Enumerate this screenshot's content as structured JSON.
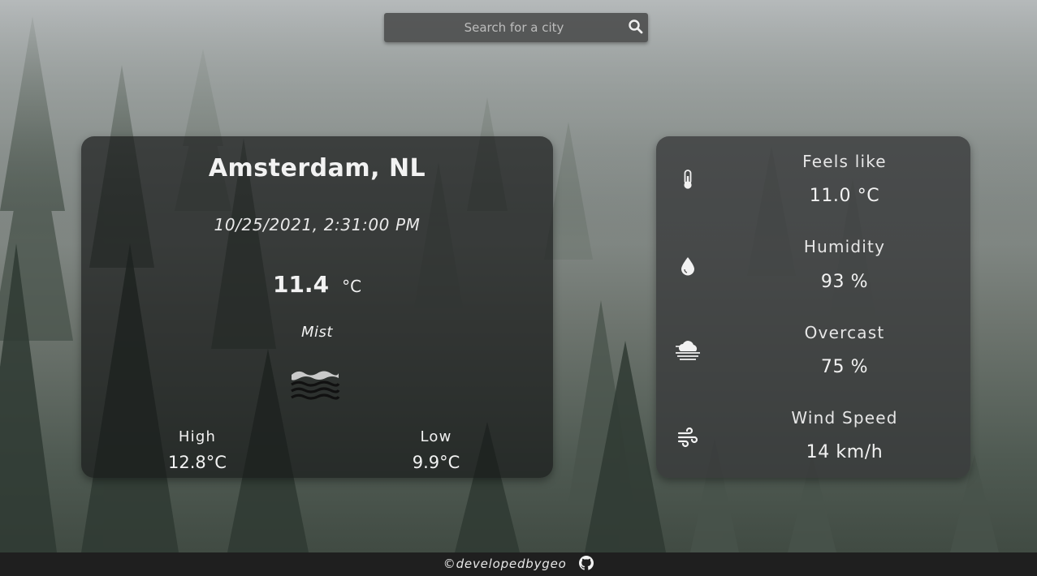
{
  "search": {
    "placeholder": "Search for a city"
  },
  "weather": {
    "location": "Amsterdam, NL",
    "datetime": "10/25/2021, 2:31:00 PM",
    "temperature": "11.4",
    "unit": "°C",
    "description": "Mist",
    "icon": "mist-icon",
    "high_label": "High",
    "high": "12.8°C",
    "low_label": "Low",
    "low": "9.9°C"
  },
  "details": [
    {
      "icon": "thermometer-icon",
      "label": "Feels like",
      "value": "11.0 °C"
    },
    {
      "icon": "water-drop-icon",
      "label": "Humidity",
      "value": "93 %"
    },
    {
      "icon": "cloud-fog-icon",
      "label": "Overcast",
      "value": "75 %"
    },
    {
      "icon": "wind-icon",
      "label": "Wind Speed",
      "value": "14 km/h"
    }
  ],
  "footer": {
    "credit": "©developedbygeo",
    "icon": "github-icon"
  }
}
